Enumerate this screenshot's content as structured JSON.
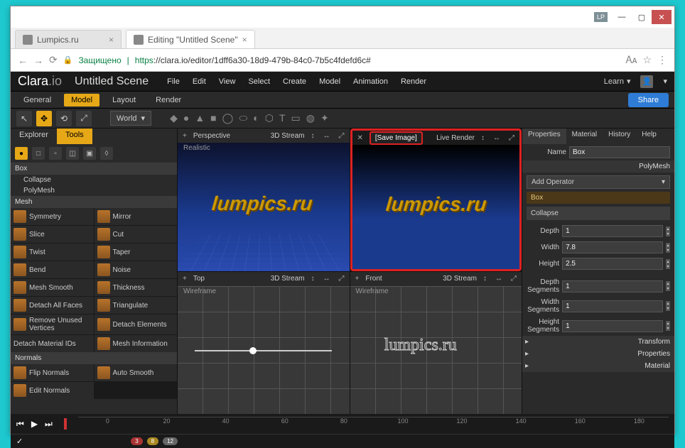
{
  "window": {
    "tag": "LP",
    "tabs": [
      {
        "title": "Lumpics.ru"
      },
      {
        "title": "Editing \"Untitled Scene\""
      }
    ],
    "secure_label": "Защищено",
    "url_proto": "https",
    "url_rest": "://clara.io/editor/1dff6a30-18d9-479b-84c0-7b5c4fdefd6c#"
  },
  "app": {
    "logo": "Clara",
    "logo_suffix": ".io",
    "scene_title": "Untitled Scene",
    "menu": [
      "File",
      "Edit",
      "View",
      "Select",
      "Create",
      "Model",
      "Animation",
      "Render"
    ],
    "learn": "Learn",
    "sec_tabs": [
      "General",
      "Model",
      "Layout",
      "Render"
    ],
    "share": "Share",
    "world": "World"
  },
  "left": {
    "tabs": [
      "Explorer",
      "Tools"
    ],
    "box_label": "Box",
    "tree": [
      "Collapse",
      "PolyMesh"
    ],
    "sections": {
      "mesh": "Mesh",
      "normals": "Normals"
    },
    "tools": [
      [
        "Symmetry",
        "Mirror"
      ],
      [
        "Slice",
        "Cut"
      ],
      [
        "Twist",
        "Taper"
      ],
      [
        "Bend",
        "Noise"
      ],
      [
        "Mesh Smooth",
        "Thickness"
      ],
      [
        "Detach All Faces",
        "Triangulate"
      ],
      [
        "Remove Unused Vertices",
        "Detach Elements"
      ],
      [
        "Detach Material IDs",
        "Mesh Information"
      ]
    ],
    "normals_tools": [
      [
        "Flip Normals",
        "Auto Smooth"
      ],
      [
        "Edit Normals",
        ""
      ]
    ]
  },
  "viewports": {
    "persp": {
      "label": "Perspective",
      "mode": "3D Stream",
      "sub": "Realistic"
    },
    "top": {
      "label": "Top",
      "mode": "3D Stream",
      "sub": "Wireframe"
    },
    "front": {
      "label": "Front",
      "mode": "3D Stream",
      "sub": "Wireframe"
    },
    "render": {
      "save": "[Save Image]",
      "live": "Live Render"
    },
    "logo_text": "lumpics.ru"
  },
  "right": {
    "tabs": [
      "Properties",
      "Material",
      "History",
      "Help"
    ],
    "name_label": "Name",
    "name_value": "Box",
    "type": "PolyMesh",
    "add_operator": "Add Operator",
    "op_item": "Box",
    "collapse": "Collapse",
    "props": [
      {
        "label": "Depth",
        "value": "1"
      },
      {
        "label": "Width",
        "value": "7.8"
      },
      {
        "label": "Height",
        "value": "2.5"
      }
    ],
    "segments": [
      {
        "label": "Depth Segments",
        "value": "1"
      },
      {
        "label": "Width Segments",
        "value": "1"
      },
      {
        "label": "Height Segments",
        "value": "1"
      }
    ],
    "sections": [
      "Transform",
      "Properties",
      "Material"
    ]
  },
  "timeline": {
    "ticks": [
      "0",
      "20",
      "40",
      "60",
      "80",
      "100",
      "120",
      "140",
      "160",
      "180"
    ]
  },
  "status": {
    "pills": [
      "3",
      "8",
      "12"
    ]
  }
}
